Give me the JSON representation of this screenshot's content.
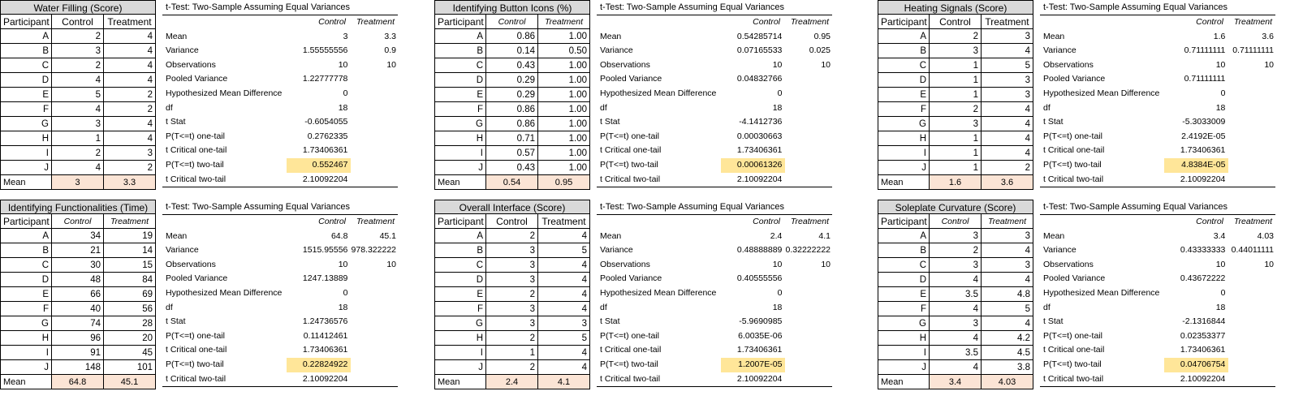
{
  "highlight_color": "#ffe699",
  "mean_color": "#fbe4d5",
  "header_color": "#d9d9d9",
  "stat_labels": [
    "Mean",
    "Variance",
    "Observations",
    "Pooled Variance",
    "Hypothesized Mean Difference",
    "df",
    "t Stat",
    "P(T<=t) one-tail",
    "t Critical one-tail",
    "P(T<=t) two-tail",
    "t Critical two-tail"
  ],
  "ttest_title": "t-Test: Two-Sample Assuming Equal Variances",
  "col_participant": "Participant",
  "col_control": "Control",
  "col_treatment": "Treatment",
  "mean_label": "Mean",
  "participants": [
    "A",
    "B",
    "C",
    "D",
    "E",
    "F",
    "G",
    "H",
    "I",
    "J"
  ],
  "blocks": [
    {
      "title": "Water Filling (Score)",
      "control": [
        "2",
        "3",
        "2",
        "4",
        "5",
        "4",
        "3",
        "1",
        "2",
        "4"
      ],
      "treatment": [
        "4",
        "4",
        "4",
        "4",
        "2",
        "2",
        "4",
        "4",
        "3",
        "2"
      ],
      "mean_control": "3",
      "mean_treatment": "3.3",
      "stats_control": [
        "3",
        "1.55555556",
        "10",
        "1.22777778",
        "0",
        "18",
        "-0.6054055",
        "0.2762335",
        "1.73406361",
        "0.552467",
        "2.10092204"
      ],
      "stats_treatment": [
        "3.3",
        "0.9",
        "10",
        "",
        "",
        "",
        "",
        "",
        "",
        "",
        ""
      ]
    },
    {
      "title": "Identifying Button Icons (%)",
      "control": [
        "0.86",
        "0.14",
        "0.43",
        "0.29",
        "0.29",
        "0.86",
        "0.86",
        "0.71",
        "0.57",
        "0.43"
      ],
      "treatment": [
        "1.00",
        "0.50",
        "1.00",
        "1.00",
        "1.00",
        "1.00",
        "1.00",
        "1.00",
        "1.00",
        "1.00"
      ],
      "mean_control": "0.54",
      "mean_treatment": "0.95",
      "stats_control": [
        "0.54285714",
        "0.07165533",
        "10",
        "0.04832766",
        "0",
        "18",
        "-4.1412736",
        "0.00030663",
        "1.73406361",
        "0.00061326",
        "2.10092204"
      ],
      "stats_treatment": [
        "0.95",
        "0.025",
        "10",
        "",
        "",
        "",
        "",
        "",
        "",
        "",
        ""
      ]
    },
    {
      "title": "Heating Signals (Score)",
      "control": [
        "2",
        "3",
        "1",
        "1",
        "1",
        "2",
        "3",
        "1",
        "1",
        "1"
      ],
      "treatment": [
        "3",
        "4",
        "5",
        "3",
        "3",
        "4",
        "4",
        "4",
        "4",
        "2"
      ],
      "mean_control": "1.6",
      "mean_treatment": "3.6",
      "stats_control": [
        "1.6",
        "0.71111111",
        "10",
        "0.71111111",
        "0",
        "18",
        "-5.3033009",
        "2.4192E-05",
        "1.73406361",
        "4.8384E-05",
        "2.10092204"
      ],
      "stats_treatment": [
        "3.6",
        "0.71111111",
        "10",
        "",
        "",
        "",
        "",
        "",
        "",
        "",
        ""
      ]
    },
    {
      "title": "Identifying Functionalities (Time)",
      "control": [
        "34",
        "21",
        "30",
        "48",
        "66",
        "40",
        "74",
        "96",
        "91",
        "148"
      ],
      "treatment": [
        "19",
        "14",
        "15",
        "84",
        "69",
        "56",
        "28",
        "20",
        "45",
        "101"
      ],
      "mean_control": "64.8",
      "mean_treatment": "45.1",
      "stats_control": [
        "64.8",
        "1515.95556",
        "10",
        "1247.13889",
        "0",
        "18",
        "1.24736576",
        "0.11412461",
        "1.73406361",
        "0.22824922",
        "2.10092204"
      ],
      "stats_treatment": [
        "45.1",
        "978.322222",
        "10",
        "",
        "",
        "",
        "",
        "",
        "",
        "",
        ""
      ]
    },
    {
      "title": "Overall Interface (Score)",
      "control": [
        "2",
        "3",
        "3",
        "3",
        "2",
        "3",
        "3",
        "2",
        "1",
        "2"
      ],
      "treatment": [
        "4",
        "5",
        "4",
        "4",
        "4",
        "4",
        "3",
        "5",
        "4",
        "4"
      ],
      "mean_control": "2.4",
      "mean_treatment": "4.1",
      "stats_control": [
        "2.4",
        "0.48888889",
        "10",
        "0.40555556",
        "0",
        "18",
        "-5.9690985",
        "6.0035E-06",
        "1.73406361",
        "1.2007E-05",
        "2.10092204"
      ],
      "stats_treatment": [
        "4.1",
        "0.32222222",
        "10",
        "",
        "",
        "",
        "",
        "",
        "",
        "",
        ""
      ]
    },
    {
      "title": "Soleplate Curvature (Score)",
      "control": [
        "3",
        "2",
        "3",
        "4",
        "3.5",
        "4",
        "3",
        "4",
        "3.5",
        "4"
      ],
      "treatment": [
        "3",
        "4",
        "3",
        "4",
        "4.8",
        "5",
        "4",
        "4.2",
        "4.5",
        "3.8"
      ],
      "mean_control": "3.4",
      "mean_treatment": "4.03",
      "stats_control": [
        "3.4",
        "0.43333333",
        "10",
        "0.43672222",
        "0",
        "18",
        "-2.1316844",
        "0.02353377",
        "1.73406361",
        "0.04706754",
        "2.10092204"
      ],
      "stats_treatment": [
        "4.03",
        "0.44011111",
        "10",
        "",
        "",
        "",
        "",
        "",
        "",
        "",
        ""
      ]
    }
  ]
}
